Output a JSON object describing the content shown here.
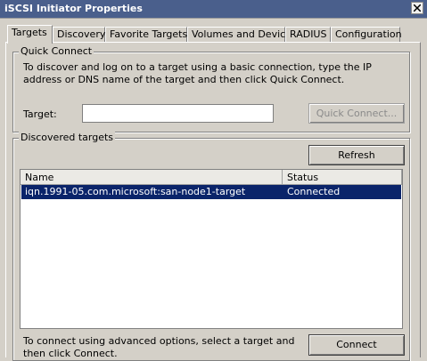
{
  "window": {
    "title": "iSCSI Initiator Properties",
    "close_icon": "close-icon"
  },
  "tabs": [
    {
      "label": "Targets",
      "active": true
    },
    {
      "label": "Discovery"
    },
    {
      "label": "Favorite Targets"
    },
    {
      "label": "Volumes and Devices"
    },
    {
      "label": "RADIUS"
    },
    {
      "label": "Configuration"
    }
  ],
  "quick_connect": {
    "group_label": "Quick Connect",
    "description": "To discover and log on to a target using a basic connection, type the IP address or DNS name of the target and then click Quick Connect.",
    "target_label": "Target:",
    "target_value": "",
    "button_label": "Quick Connect..."
  },
  "discovered_targets": {
    "group_label": "Discovered targets",
    "refresh_label": "Refresh",
    "columns": [
      "Name",
      "Status"
    ],
    "rows": [
      {
        "name": "iqn.1991-05.com.microsoft:san-node1-target",
        "status": "Connected",
        "selected": true
      }
    ],
    "footer_text": "To connect using advanced options, select a target and then click Connect.",
    "connect_label": "Connect"
  },
  "colors": {
    "titlebar": "#4a5f8c",
    "selection": "#0a246a",
    "face": "#d4d0c8"
  }
}
